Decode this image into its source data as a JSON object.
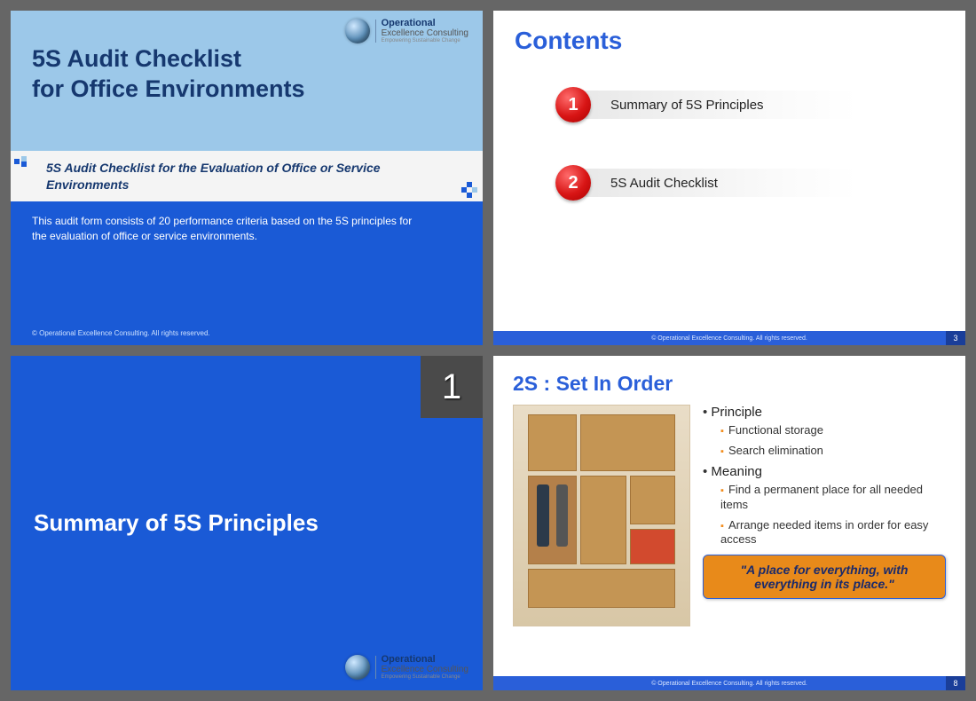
{
  "slides": {
    "s1": {
      "logo": {
        "name": "Operational",
        "sub": "Excellence Consulting",
        "tag": "Empowering Sustainable Change"
      },
      "title_line1": "5S Audit Checklist",
      "title_line2": "for Office Environments",
      "subtitle": "5S Audit Checklist for the Evaluation of Office or Service Environments",
      "body": "This audit form consists of 20 performance criteria based on the 5S principles for the evaluation of office or service environments.",
      "footer": "© Operational Excellence Consulting.  All rights reserved."
    },
    "s2": {
      "title": "Contents",
      "items": [
        {
          "num": "1",
          "label": "Summary of 5S Principles"
        },
        {
          "num": "2",
          "label": "5S Audit Checklist"
        }
      ],
      "footer": "© Operational Excellence Consulting.  All rights reserved.",
      "page": "3"
    },
    "s3": {
      "num": "1",
      "title": "Summary of 5S Principles",
      "logo": {
        "name": "Operational",
        "sub": "Excellence Consulting",
        "tag": "Empowering Sustainable Change"
      }
    },
    "s4": {
      "title": "2S : Set In Order",
      "principle_label": "Principle",
      "principle_items": [
        "Functional storage",
        "Search elimination"
      ],
      "meaning_label": "Meaning",
      "meaning_items": [
        "Find a permanent place for all needed items",
        "Arrange needed items in order for easy access"
      ],
      "callout": "\"A place for everything, with everything in its place.\"",
      "footer": "© Operational Excellence Consulting.  All rights reserved.",
      "page": "8"
    }
  }
}
